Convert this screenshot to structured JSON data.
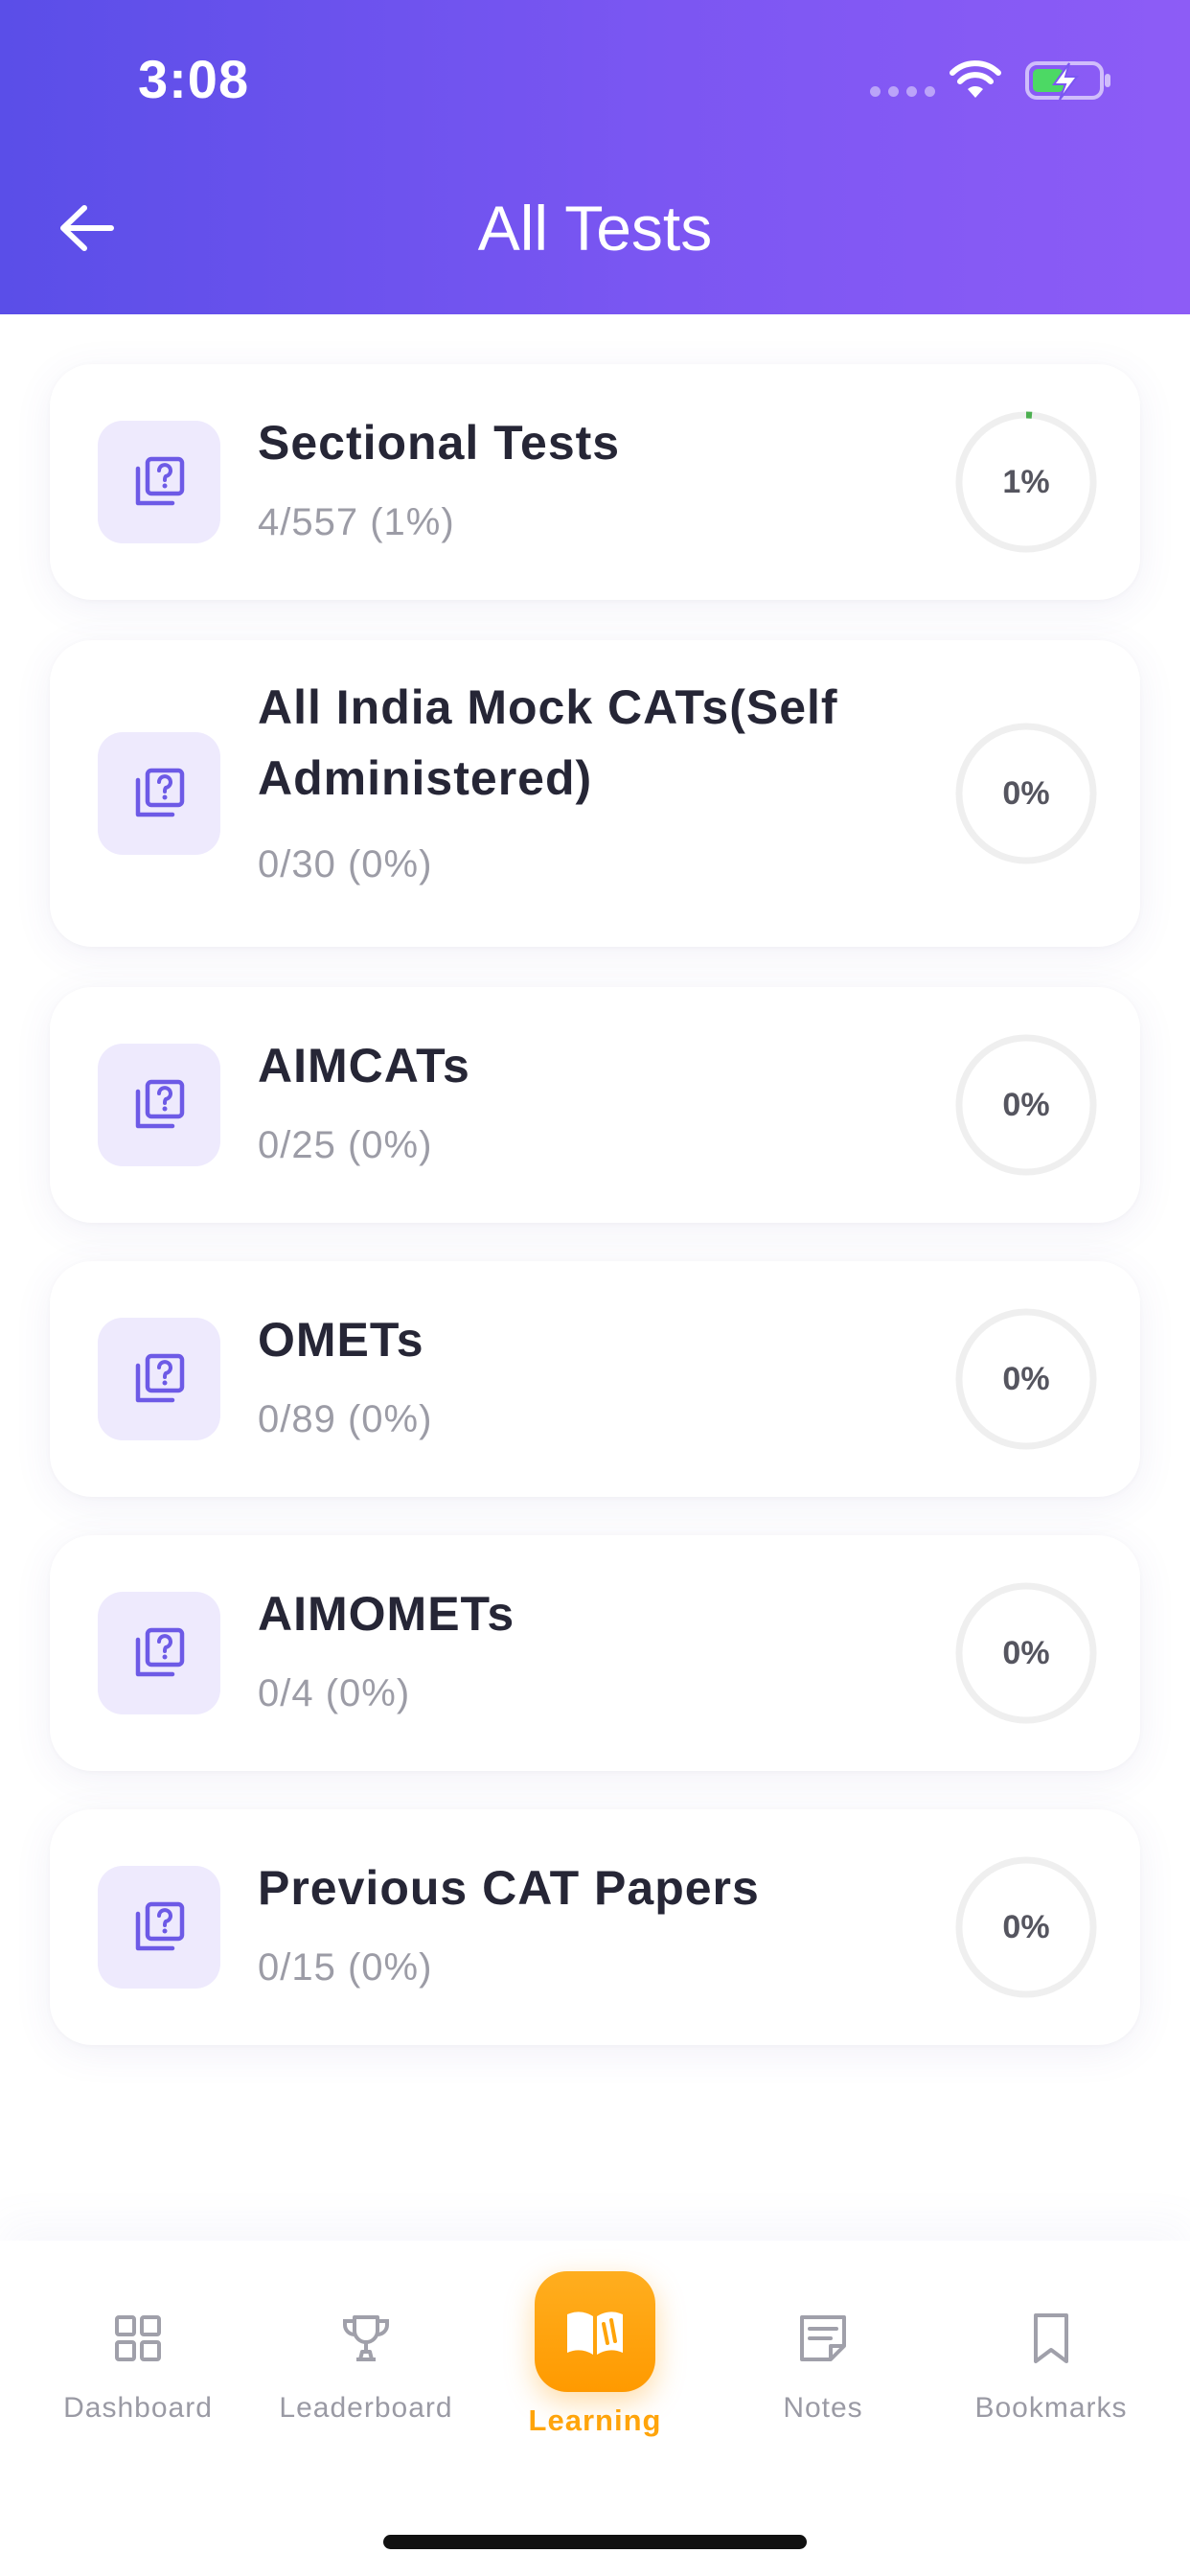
{
  "status_bar": {
    "time": "3:08"
  },
  "header": {
    "title": "All Tests",
    "back_icon": "arrow-left-icon"
  },
  "colors": {
    "header_gradient_start": "#5a4ee8",
    "header_gradient_end": "#8d5cf6",
    "accent": "#6d5ae6",
    "active_tab": "#ffa40a",
    "progress_fill": "#4caf50"
  },
  "tests": [
    {
      "title": "Sectional Tests",
      "subtitle": "4/557 (1%)",
      "progress_label": "1%",
      "progress": 0.01,
      "icon": "quiz-stack-icon"
    },
    {
      "title": "All India Mock CATs(Self Administered)",
      "subtitle": "0/30 (0%)",
      "progress_label": "0%",
      "progress": 0,
      "icon": "quiz-stack-icon"
    },
    {
      "title": "AIMCATs",
      "subtitle": "0/25 (0%)",
      "progress_label": "0%",
      "progress": 0,
      "icon": "quiz-stack-icon"
    },
    {
      "title": "OMETs",
      "subtitle": "0/89 (0%)",
      "progress_label": "0%",
      "progress": 0,
      "icon": "quiz-stack-icon"
    },
    {
      "title": "AIMOMETs",
      "subtitle": "0/4 (0%)",
      "progress_label": "0%",
      "progress": 0,
      "icon": "quiz-stack-icon"
    },
    {
      "title": "Previous CAT Papers",
      "subtitle": "0/15 (0%)",
      "progress_label": "0%",
      "progress": 0,
      "icon": "quiz-stack-icon"
    }
  ],
  "nav": {
    "items": [
      {
        "label": "Dashboard",
        "icon": "grid-icon"
      },
      {
        "label": "Leaderboard",
        "icon": "trophy-icon"
      },
      {
        "label": "Learning",
        "icon": "open-book-icon",
        "active": true
      },
      {
        "label": "Notes",
        "icon": "note-icon"
      },
      {
        "label": "Bookmarks",
        "icon": "bookmark-icon"
      }
    ]
  }
}
